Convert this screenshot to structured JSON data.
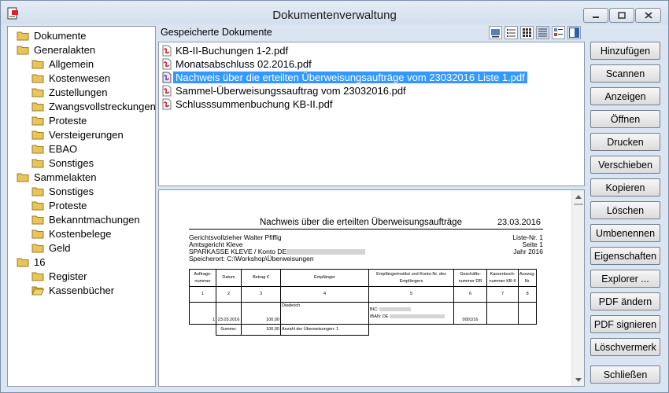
{
  "window": {
    "title": "Dokumentenverwaltung"
  },
  "tree": {
    "items": [
      {
        "label": "Dokumente",
        "level": 0
      },
      {
        "label": "Generalakten",
        "level": 1
      },
      {
        "label": "Allgemein",
        "level": 2
      },
      {
        "label": "Kostenwesen",
        "level": 2
      },
      {
        "label": "Zustellungen",
        "level": 2
      },
      {
        "label": "Zwangsvollstreckungen",
        "level": 2
      },
      {
        "label": "Proteste",
        "level": 2
      },
      {
        "label": "Versteigerungen",
        "level": 2
      },
      {
        "label": "EBAO",
        "level": 2
      },
      {
        "label": "Sonstiges",
        "level": 2
      },
      {
        "label": "Sammelakten",
        "level": 1
      },
      {
        "label": "Sonstiges",
        "level": 2
      },
      {
        "label": "Proteste",
        "level": 2
      },
      {
        "label": "Bekanntmachungen",
        "level": 2
      },
      {
        "label": "Kostenbelege",
        "level": 2
      },
      {
        "label": "Geld",
        "level": 2
      },
      {
        "label": "16",
        "level": 1
      },
      {
        "label": "Register",
        "level": 2
      },
      {
        "label": "Kassenbücher",
        "level": 2
      }
    ]
  },
  "documents": {
    "heading": "Gespeicherte Dokumente",
    "files": [
      "KB-II-Buchungen 1-2.pdf",
      "Monatsabschluss 02.2016.pdf",
      "Nachweis über die erteilten Überweisungsaufträge vom 23032016 Liste 1.pdf",
      "Sammel-Überweisungssauftrag vom 23032016.pdf",
      "Schlusssummenbuchung KB-II.pdf"
    ],
    "selected_index": 2
  },
  "preview": {
    "title": "Nachweis über die erteilten Überweisungsaufträge",
    "date": "23.03.2016",
    "left_lines": [
      "Gerichtsvollzieher Walter Pfiffig",
      "Amtsgericht Kleve",
      "SPARKASSE KLEVE / Konto DE",
      "Speicherort: C:\\Workshop\\Überweisungen"
    ],
    "right_lines": [
      "Liste-Nr. 1",
      "Seite 1",
      "Jahr 2016"
    ],
    "table": {
      "headers": [
        "Auftrags-nummer",
        "Datum",
        "Betrag €",
        "Empfänger",
        "Empfängerinstitut und Konto-Nr. des Empfängers",
        "Geschäfts-nummer DR",
        "Kassenbuch-nummer KB-II",
        "Auszug-Nr."
      ],
      "col_numbers": [
        "1",
        "2",
        "3",
        "4",
        "5",
        "6",
        "7",
        "8"
      ],
      "row": {
        "nr": "1",
        "datum": "23.03.2016",
        "betrag": "100,00",
        "empfaenger": "Diederich",
        "bic": "BIC:",
        "iban": "IBAN: DE",
        "dr": "0001/16"
      },
      "summary": {
        "label": "Summe:",
        "betrag": "100,00",
        "count_label": "Anzahl der Überweisungen: 1"
      }
    }
  },
  "buttons": [
    "Hinzufügen",
    "Scannen",
    "Anzeigen",
    "Öffnen",
    "Drucken",
    "Verschieben",
    "Kopieren",
    "Löschen",
    "Umbenennen",
    "Eigenschaften",
    "Explorer ...",
    "PDF ändern",
    "PDF signieren",
    "Löschvermerk",
    "Schließen"
  ],
  "colors": {
    "selection": "#3399ff",
    "folder": "#e8c45a",
    "window_bg": "#dbe5f1"
  }
}
